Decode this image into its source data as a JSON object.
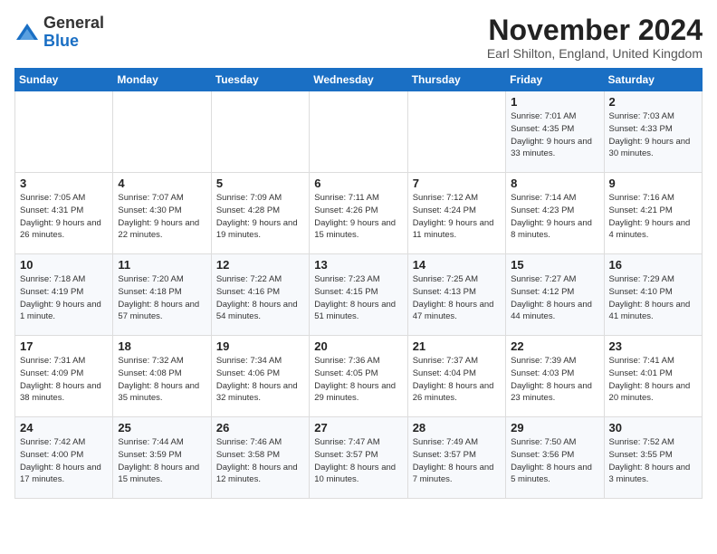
{
  "logo": {
    "general": "General",
    "blue": "Blue"
  },
  "title": "November 2024",
  "location": "Earl Shilton, England, United Kingdom",
  "days_of_week": [
    "Sunday",
    "Monday",
    "Tuesday",
    "Wednesday",
    "Thursday",
    "Friday",
    "Saturday"
  ],
  "weeks": [
    [
      {
        "day": "",
        "info": ""
      },
      {
        "day": "",
        "info": ""
      },
      {
        "day": "",
        "info": ""
      },
      {
        "day": "",
        "info": ""
      },
      {
        "day": "",
        "info": ""
      },
      {
        "day": "1",
        "info": "Sunrise: 7:01 AM\nSunset: 4:35 PM\nDaylight: 9 hours and 33 minutes."
      },
      {
        "day": "2",
        "info": "Sunrise: 7:03 AM\nSunset: 4:33 PM\nDaylight: 9 hours and 30 minutes."
      }
    ],
    [
      {
        "day": "3",
        "info": "Sunrise: 7:05 AM\nSunset: 4:31 PM\nDaylight: 9 hours and 26 minutes."
      },
      {
        "day": "4",
        "info": "Sunrise: 7:07 AM\nSunset: 4:30 PM\nDaylight: 9 hours and 22 minutes."
      },
      {
        "day": "5",
        "info": "Sunrise: 7:09 AM\nSunset: 4:28 PM\nDaylight: 9 hours and 19 minutes."
      },
      {
        "day": "6",
        "info": "Sunrise: 7:11 AM\nSunset: 4:26 PM\nDaylight: 9 hours and 15 minutes."
      },
      {
        "day": "7",
        "info": "Sunrise: 7:12 AM\nSunset: 4:24 PM\nDaylight: 9 hours and 11 minutes."
      },
      {
        "day": "8",
        "info": "Sunrise: 7:14 AM\nSunset: 4:23 PM\nDaylight: 9 hours and 8 minutes."
      },
      {
        "day": "9",
        "info": "Sunrise: 7:16 AM\nSunset: 4:21 PM\nDaylight: 9 hours and 4 minutes."
      }
    ],
    [
      {
        "day": "10",
        "info": "Sunrise: 7:18 AM\nSunset: 4:19 PM\nDaylight: 9 hours and 1 minute."
      },
      {
        "day": "11",
        "info": "Sunrise: 7:20 AM\nSunset: 4:18 PM\nDaylight: 8 hours and 57 minutes."
      },
      {
        "day": "12",
        "info": "Sunrise: 7:22 AM\nSunset: 4:16 PM\nDaylight: 8 hours and 54 minutes."
      },
      {
        "day": "13",
        "info": "Sunrise: 7:23 AM\nSunset: 4:15 PM\nDaylight: 8 hours and 51 minutes."
      },
      {
        "day": "14",
        "info": "Sunrise: 7:25 AM\nSunset: 4:13 PM\nDaylight: 8 hours and 47 minutes."
      },
      {
        "day": "15",
        "info": "Sunrise: 7:27 AM\nSunset: 4:12 PM\nDaylight: 8 hours and 44 minutes."
      },
      {
        "day": "16",
        "info": "Sunrise: 7:29 AM\nSunset: 4:10 PM\nDaylight: 8 hours and 41 minutes."
      }
    ],
    [
      {
        "day": "17",
        "info": "Sunrise: 7:31 AM\nSunset: 4:09 PM\nDaylight: 8 hours and 38 minutes."
      },
      {
        "day": "18",
        "info": "Sunrise: 7:32 AM\nSunset: 4:08 PM\nDaylight: 8 hours and 35 minutes."
      },
      {
        "day": "19",
        "info": "Sunrise: 7:34 AM\nSunset: 4:06 PM\nDaylight: 8 hours and 32 minutes."
      },
      {
        "day": "20",
        "info": "Sunrise: 7:36 AM\nSunset: 4:05 PM\nDaylight: 8 hours and 29 minutes."
      },
      {
        "day": "21",
        "info": "Sunrise: 7:37 AM\nSunset: 4:04 PM\nDaylight: 8 hours and 26 minutes."
      },
      {
        "day": "22",
        "info": "Sunrise: 7:39 AM\nSunset: 4:03 PM\nDaylight: 8 hours and 23 minutes."
      },
      {
        "day": "23",
        "info": "Sunrise: 7:41 AM\nSunset: 4:01 PM\nDaylight: 8 hours and 20 minutes."
      }
    ],
    [
      {
        "day": "24",
        "info": "Sunrise: 7:42 AM\nSunset: 4:00 PM\nDaylight: 8 hours and 17 minutes."
      },
      {
        "day": "25",
        "info": "Sunrise: 7:44 AM\nSunset: 3:59 PM\nDaylight: 8 hours and 15 minutes."
      },
      {
        "day": "26",
        "info": "Sunrise: 7:46 AM\nSunset: 3:58 PM\nDaylight: 8 hours and 12 minutes."
      },
      {
        "day": "27",
        "info": "Sunrise: 7:47 AM\nSunset: 3:57 PM\nDaylight: 8 hours and 10 minutes."
      },
      {
        "day": "28",
        "info": "Sunrise: 7:49 AM\nSunset: 3:57 PM\nDaylight: 8 hours and 7 minutes."
      },
      {
        "day": "29",
        "info": "Sunrise: 7:50 AM\nSunset: 3:56 PM\nDaylight: 8 hours and 5 minutes."
      },
      {
        "day": "30",
        "info": "Sunrise: 7:52 AM\nSunset: 3:55 PM\nDaylight: 8 hours and 3 minutes."
      }
    ]
  ]
}
